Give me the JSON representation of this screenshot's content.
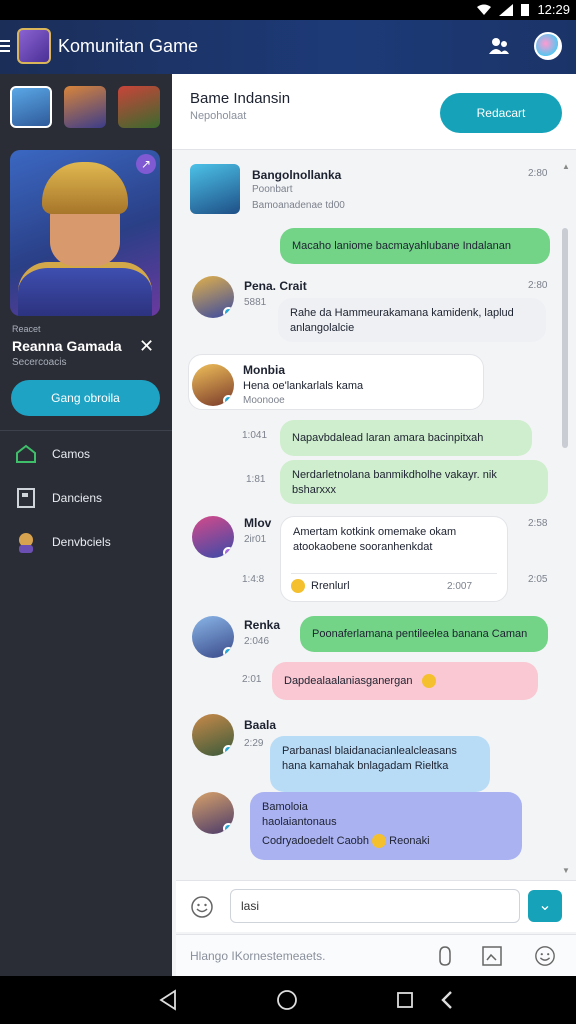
{
  "status_bar": {
    "time": "12:29"
  },
  "app_bar": {
    "title": "Komunitan Game"
  },
  "sidebar": {
    "hero": {
      "small_label": "Reacet",
      "name": "Reanna Gamada",
      "subtitle": "Secercoacis",
      "join_button": "Gang obroila"
    },
    "nav": [
      {
        "label": "Camos",
        "icon": "home-icon"
      },
      {
        "label": "Danciens",
        "icon": "card-icon"
      },
      {
        "label": "Denvbciels",
        "icon": "hero-icon"
      }
    ]
  },
  "chat_header": {
    "title": "Bame Indansin",
    "subtitle": "Nepoholaat",
    "action_button": "Redacart"
  },
  "pinned_card": {
    "title": "Bangolnollanka",
    "line1": "Poonbart",
    "line2": "Bamoanadenae td00",
    "time": "2:80"
  },
  "messages": [
    {
      "text": "Macaho laniome bacmayahlubane Indalanan",
      "style": "green"
    },
    {
      "name": "Pena. Crait",
      "meta": "5881",
      "time": "2:80",
      "text": "Rahe da Hammeurakamana kamidenk, laplud anlangolalcie"
    },
    {
      "name": "Monbia",
      "text1": "Hena oe'lankarlals kama",
      "text2": "Moonooe"
    },
    {
      "time": "1:041",
      "text": "Napavbdalead laran amara bacinpitxah"
    },
    {
      "time": "1:81",
      "text": "Nerdarletnolana banmikdholhe vakayr. nik bsharxxx"
    },
    {
      "name": "Mlov",
      "meta": "2ir01",
      "time": "2:58",
      "text": "Amertam kotkink omemake okam atookaobene sooranhenkdat"
    },
    {
      "time": "1:4:8",
      "text": "Rrenlurl",
      "time2": "2:007",
      "time3": "2:05"
    },
    {
      "name": "Renka",
      "meta": "2:046",
      "text": "Poonaferlamana pentileelea banana Caman"
    },
    {
      "time": "2:01",
      "text": "Dapdealaalaniasganergan"
    },
    {
      "name": "Baala",
      "meta": "2:29",
      "text": "Parbanasl blaidanacianlealcleasans hana kamahak bnlagadam Rieltka"
    },
    {
      "text1": "Bamoloia",
      "text2": "haolaiantonaus",
      "text3": "Codryadoedelt",
      "text4": "Caobh",
      "text5": "Reonaki"
    }
  ],
  "composer": {
    "input_value": "lasi"
  },
  "footer": {
    "placeholder": "Hlango IKornestemeaets."
  },
  "colors": {
    "accent": "#16a2b8",
    "sidebar": "#2a2d35",
    "appbar": "#1d3a78"
  }
}
